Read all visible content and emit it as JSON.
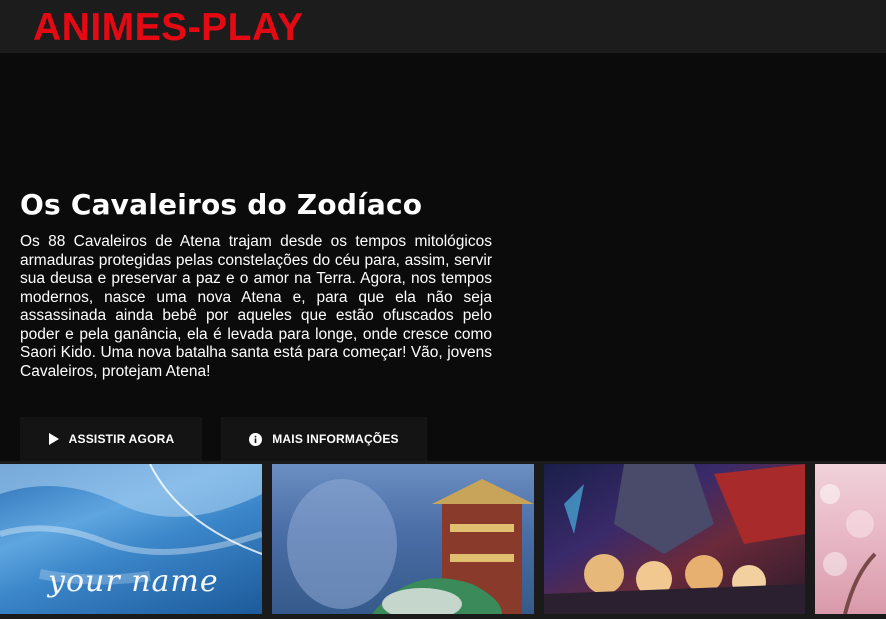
{
  "header": {
    "logo": "ANIMES-PLAY"
  },
  "hero": {
    "title": "Os Cavaleiros do Zodíaco",
    "description": "Os 88 Cavaleiros de Atena trajam desde os tempos mitológicos armaduras protegidas pelas constelações do céu para, assim, servir sua deusa e preservar a paz e o amor na Terra. Agora, nos tempos modernos, nasce uma nova Atena e, para que ela não seja assassinada ainda bebê por aqueles que estão ofuscados pelo poder e pela ganância, ela é levada para longe, onde cresce como Saori Kido. Uma nova batalha santa está para começar! Vão, jovens Cavaleiros, protejam Atena!",
    "buttons": {
      "watch_label": "ASSISTIR AGORA",
      "info_label": "MAIS INFORMAÇÕES"
    }
  },
  "thumbnails": [
    {
      "logo_text": "your name"
    },
    {},
    {},
    {}
  ],
  "colors": {
    "brand": "#e50914",
    "header_bg": "#1c1c1c",
    "page_bg": "#0b0b0b",
    "button_bg": "#141414"
  },
  "icons": {
    "watch": "play-icon",
    "info": "info-icon"
  }
}
